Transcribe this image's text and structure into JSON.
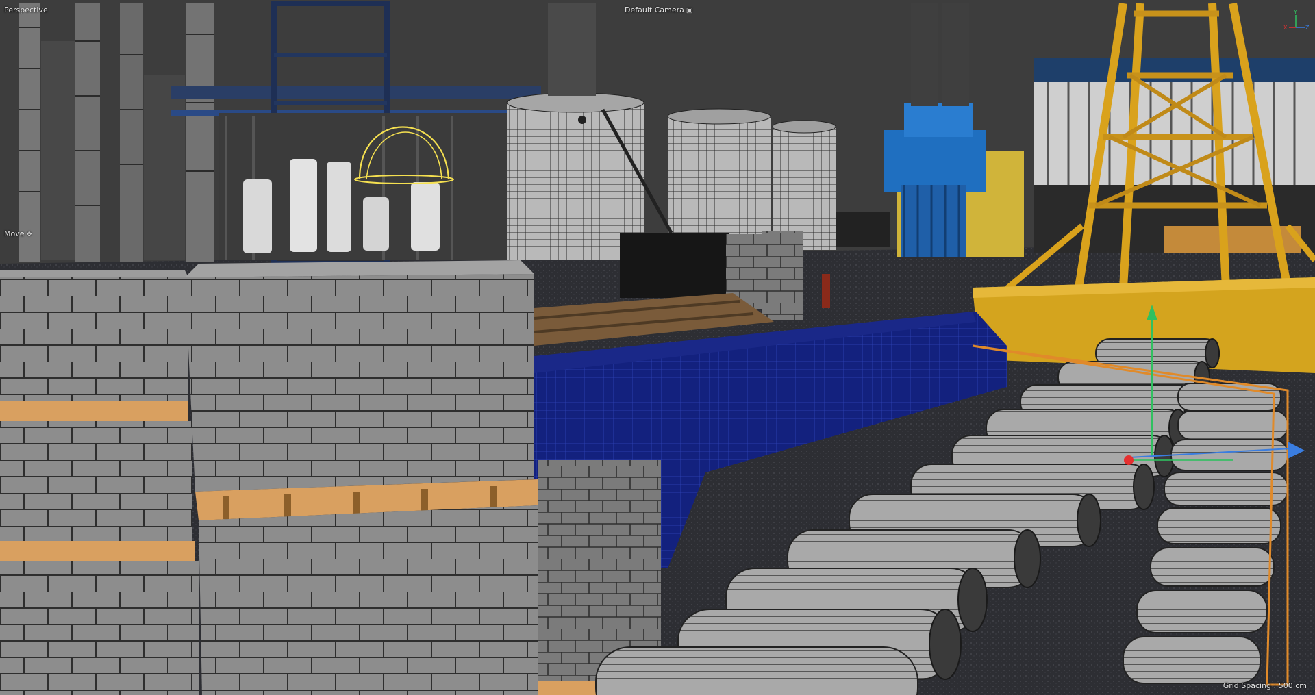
{
  "viewport": {
    "view_name": "Perspective",
    "camera": "Default Camera",
    "camera_icon": "camera-icon",
    "tool": "Move",
    "tool_icon": "move-icon",
    "grid_spacing": "Grid Spacing : 500 cm"
  },
  "axis_gizmo": {
    "x": "X",
    "y": "Y",
    "z": "Z"
  },
  "colors": {
    "background": "#3d3d3d",
    "selection": "#f5e050",
    "crane": "#d9a21c",
    "tarp": "#101c72",
    "wire": "#000000",
    "axis_x": "#e53030",
    "axis_y": "#30c060",
    "axis_z": "#3a7de0"
  }
}
